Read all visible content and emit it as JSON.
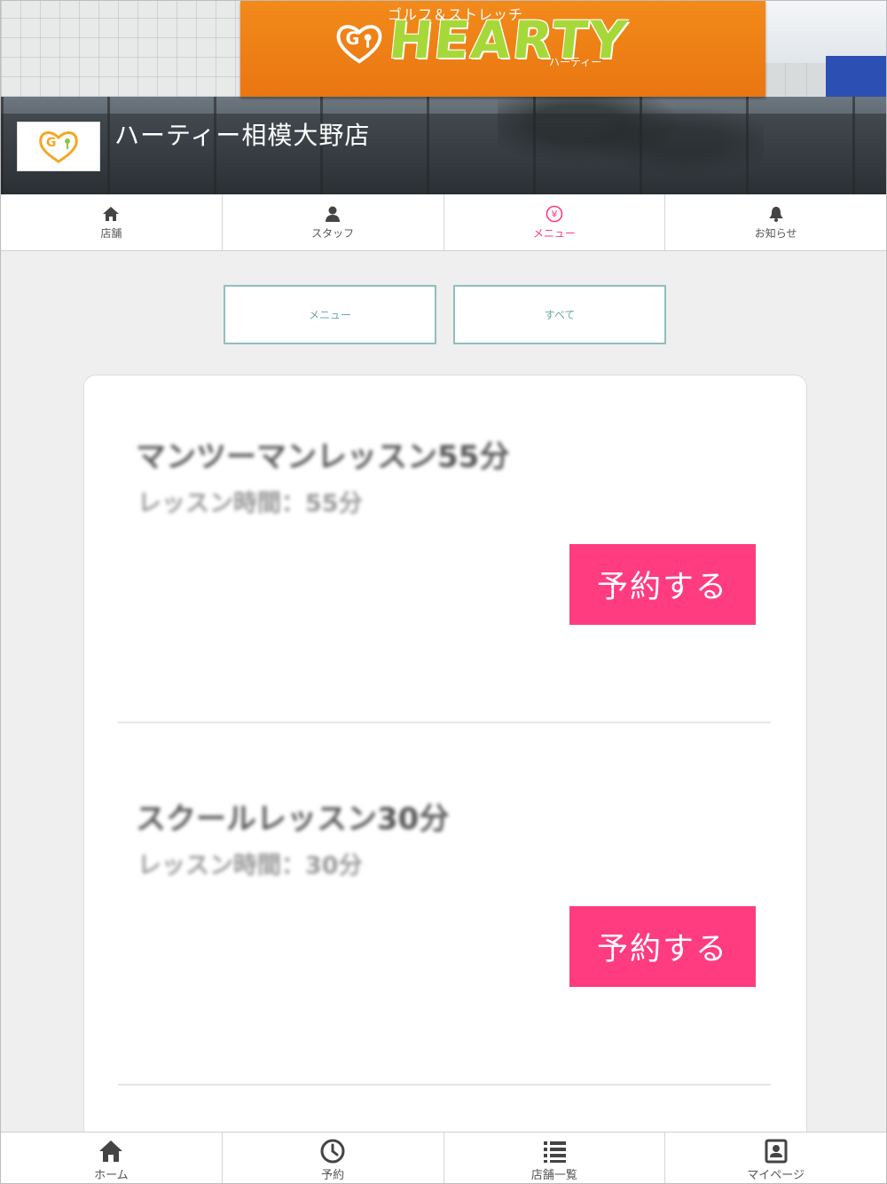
{
  "store": {
    "name": "ハーティー相模大野店",
    "sign_word": "HEARTY",
    "sign_subtitle": "ゴルフ＆ストレッチ",
    "sign_kana": "ハーティー",
    "logo_text": "HEARTY"
  },
  "tabs": [
    {
      "label": "店舗",
      "icon": "home-icon"
    },
    {
      "label": "スタッフ",
      "icon": "person-icon"
    },
    {
      "label": "メニュー",
      "icon": "yen-icon",
      "active": true
    },
    {
      "label": "お知らせ",
      "icon": "bell-icon"
    }
  ],
  "filters": {
    "menu_label": "メニュー",
    "all_label": "すべて"
  },
  "menu_items": [
    {
      "title": "マンツーマンレッスン55分",
      "duration": "レッスン時間：55分",
      "button": "予約する"
    },
    {
      "title": "スクールレッスン30分",
      "duration": "レッスン時間：30分",
      "button": "予約する"
    }
  ],
  "bottom_nav": [
    {
      "label": "ホーム",
      "icon": "home-icon"
    },
    {
      "label": "予約",
      "icon": "clock-icon"
    },
    {
      "label": "店舗一覧",
      "icon": "list-icon"
    },
    {
      "label": "マイページ",
      "icon": "profile-card-icon"
    }
  ],
  "colors": {
    "accent_pink": "#ff3c80",
    "active_tab": "#ff3d7f",
    "filter_border": "#8fbfbc",
    "sign_orange": "#ea7612",
    "logo_green": "#a6d83a"
  }
}
